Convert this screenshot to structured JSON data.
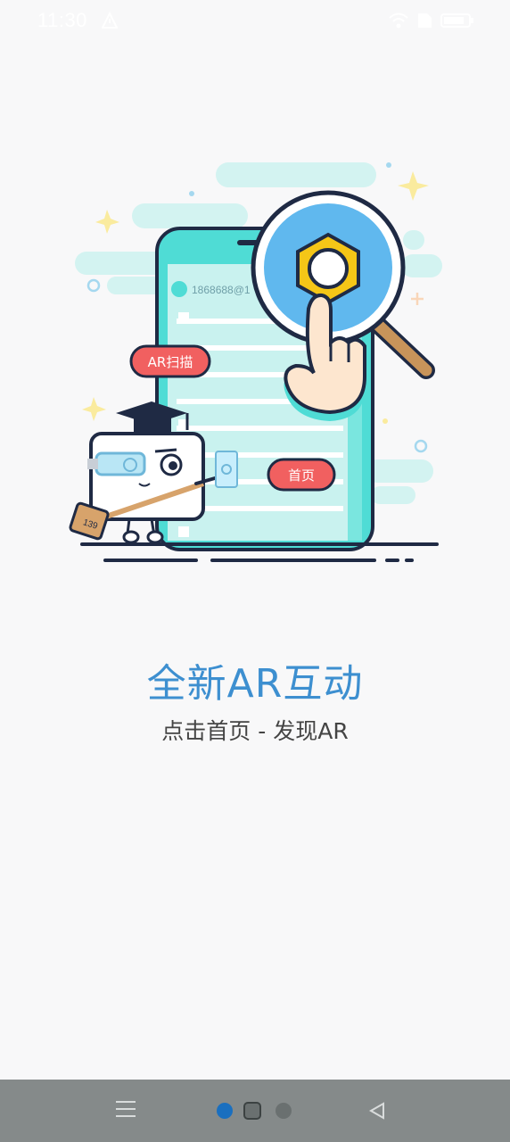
{
  "status_bar": {
    "time": "11:30",
    "icons": [
      "alert-icon",
      "wifi-icon",
      "sim-icon",
      "battery-icon"
    ]
  },
  "illustration": {
    "phone_account": "1868688@1",
    "ar_scan_button_label": "AR扫描",
    "home_button_label": "首页",
    "mascot_tag": "139"
  },
  "headline": "全新AR互动",
  "subline": "点击首页 - 发现AR",
  "colors": {
    "accent_blue": "#3d8fd0",
    "teal": "#4fd9d4",
    "light_teal": "#c9f2ef",
    "button_red": "#f16060",
    "nut_yellow": "#f5c617",
    "nav_bar": "#858a8a",
    "nav_dot_active": "#1a6fbf"
  },
  "nav": {
    "icons": [
      "menu-icon",
      "home-indicator-dots",
      "back-icon"
    ]
  }
}
